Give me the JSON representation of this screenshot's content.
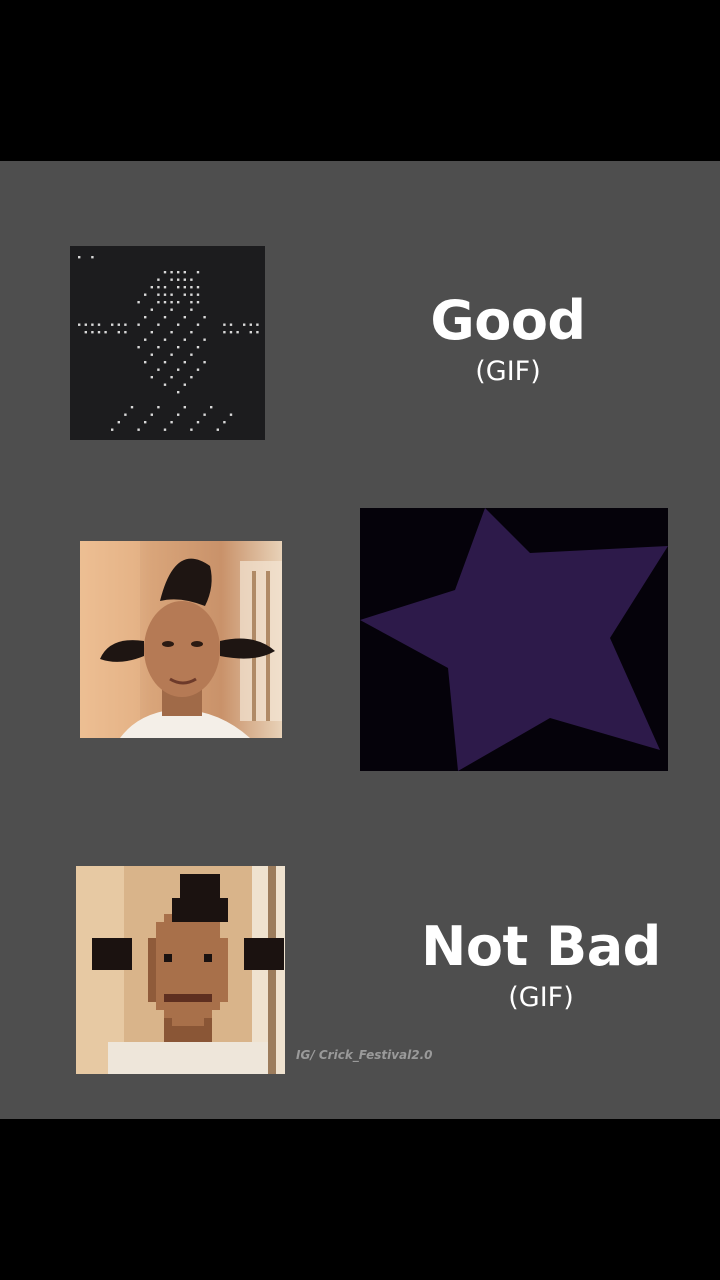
{
  "captions": {
    "good": {
      "main": "Good",
      "sub": "(GIF)"
    },
    "not_bad": {
      "main": "Not Bad",
      "sub": "(GIF)"
    }
  },
  "watermark": "IG/ Crick_Festival2.0",
  "colors": {
    "background": "#4e4e4e",
    "letterbox": "#000000",
    "star": "#2d1a4a",
    "star_panel_bg": "#05020a",
    "ascii_bg": "#1c1c1e"
  },
  "icons": {
    "ascii_art": "ascii-portrait",
    "star": "star-shape"
  }
}
